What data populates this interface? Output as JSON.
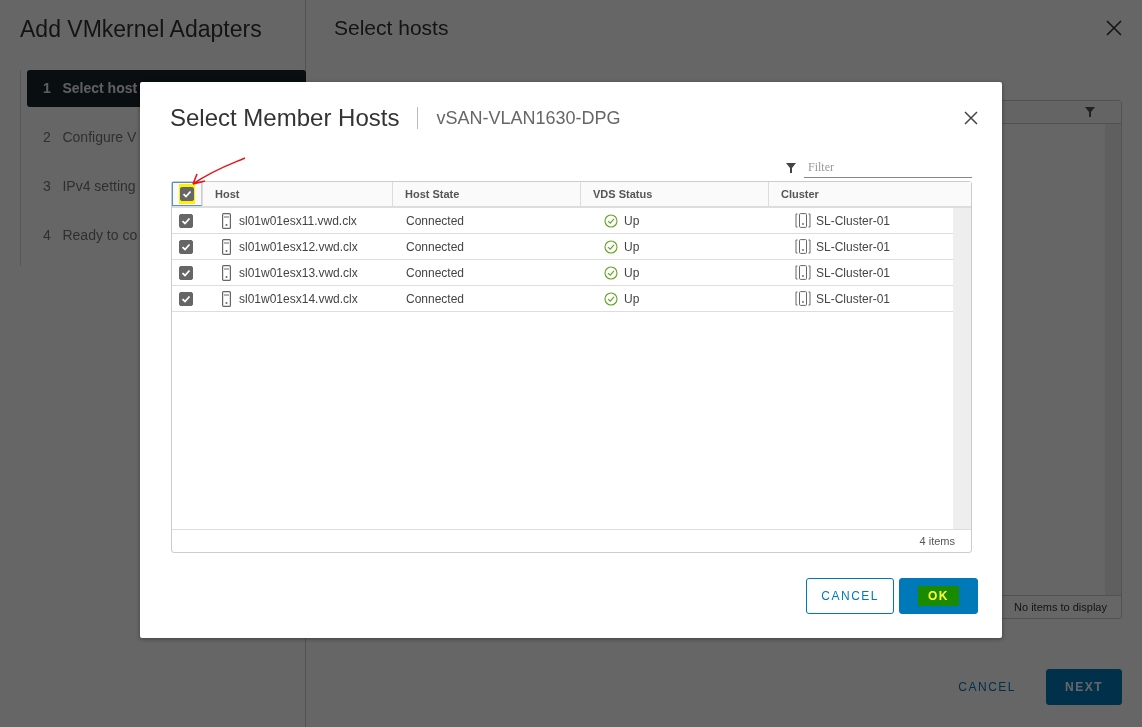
{
  "wizard": {
    "title": "Add VMkernel Adapters",
    "steps": [
      {
        "number": "1",
        "label": "Select host",
        "selected": true
      },
      {
        "number": "2",
        "label": "Configure V",
        "selected": false
      },
      {
        "number": "3",
        "label": "IPv4 setting",
        "selected": false
      },
      {
        "number": "4",
        "label": "Ready to co",
        "selected": false
      }
    ],
    "page_title": "Select hosts",
    "grid_footer": "No items to display",
    "buttons": [
      {
        "label": "CANCEL",
        "kind": "flat"
      },
      {
        "label": "NEXT",
        "kind": "primary"
      }
    ]
  },
  "dialog": {
    "title": "Select Member Hosts",
    "subtitle": "vSAN-VLAN1630-DPG",
    "filter": {
      "placeholder": "Filter"
    },
    "select_all": {
      "checked": true
    },
    "columns": [
      "Host",
      "Host State",
      "VDS Status",
      "Cluster"
    ],
    "rows": [
      {
        "checked": true,
        "host": "sl01w01esx11.vwd.clx",
        "state": "Connected",
        "vds_status": "Up",
        "cluster": "SL-Cluster-01"
      },
      {
        "checked": true,
        "host": "sl01w01esx12.vwd.clx",
        "state": "Connected",
        "vds_status": "Up",
        "cluster": "SL-Cluster-01"
      },
      {
        "checked": true,
        "host": "sl01w01esx13.vwd.clx",
        "state": "Connected",
        "vds_status": "Up",
        "cluster": "SL-Cluster-01"
      },
      {
        "checked": true,
        "host": "sl01w01esx14.vwd.clx",
        "state": "Connected",
        "vds_status": "Up",
        "cluster": "SL-Cluster-01"
      }
    ],
    "footer": "4 items",
    "buttons": [
      {
        "label": "CANCEL",
        "kind": "outline"
      },
      {
        "label": "OK",
        "kind": "primary"
      }
    ]
  }
}
